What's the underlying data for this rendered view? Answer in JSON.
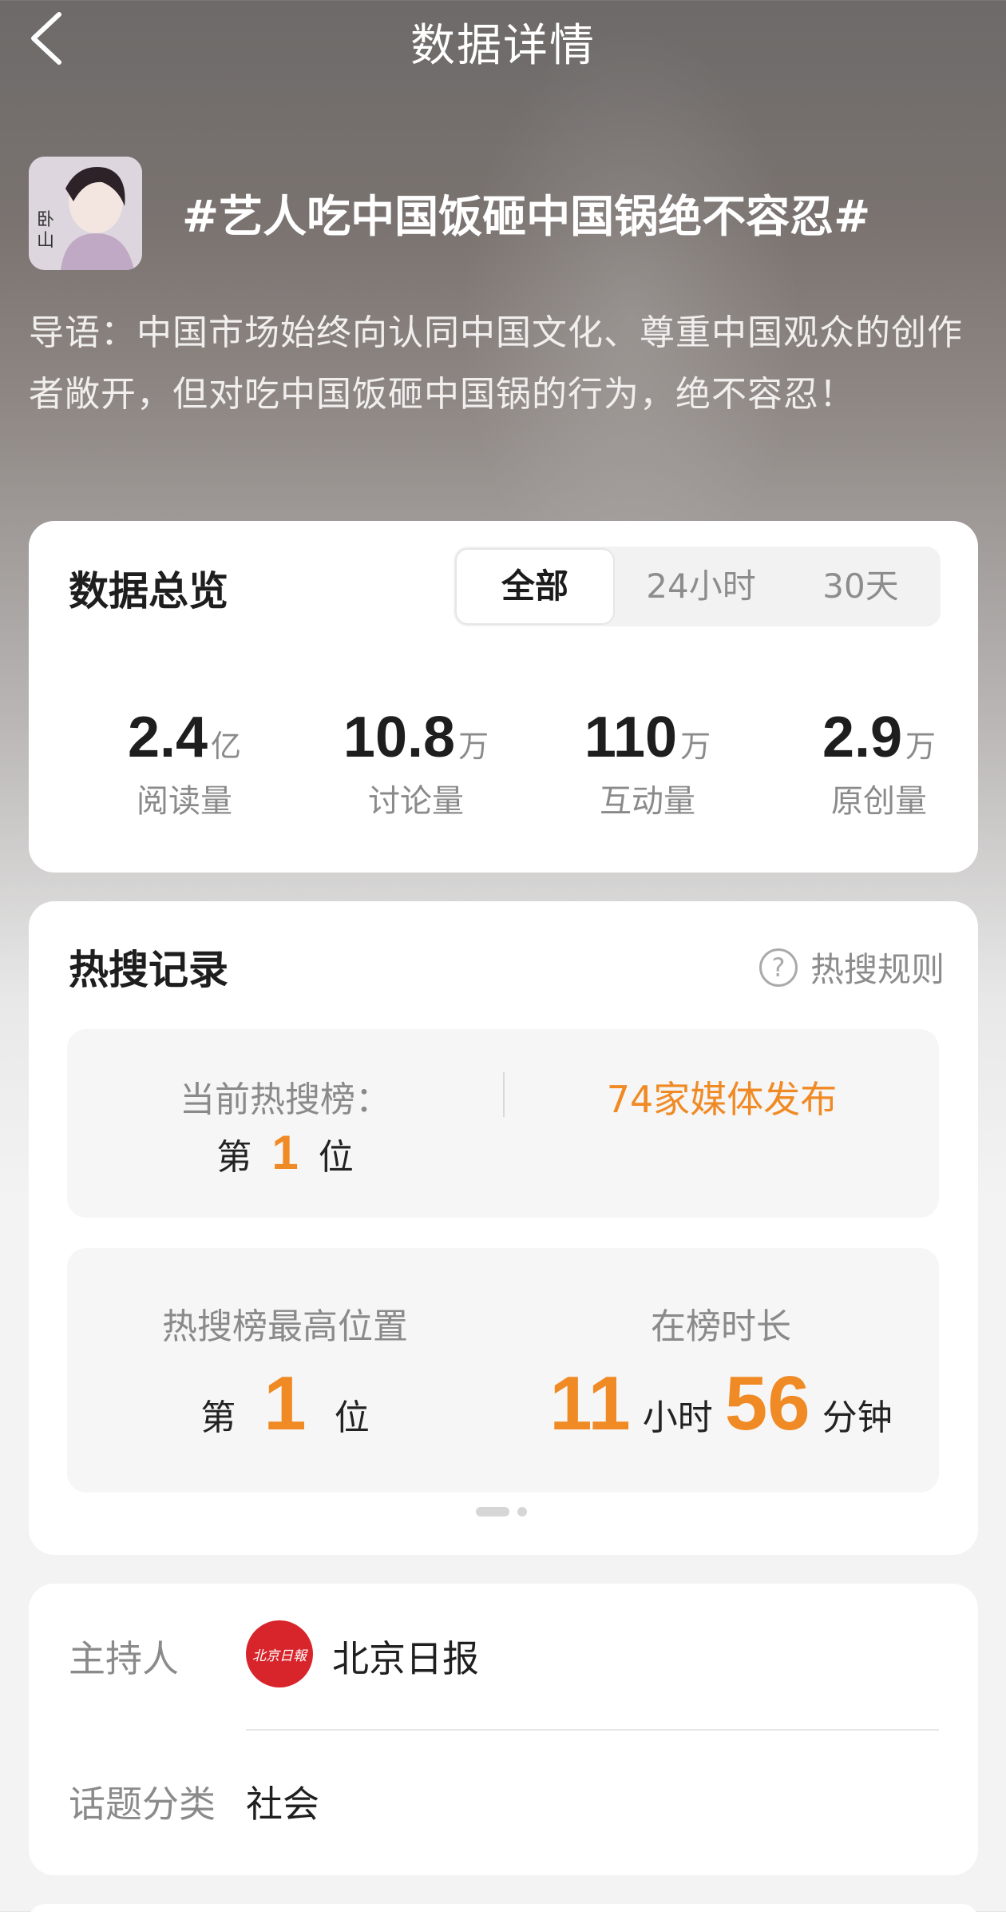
{
  "header": {
    "title": "数据详情"
  },
  "topic": {
    "title": "#艺人吃中国饭砸中国锅绝不容忍#",
    "intro": "导语：中国市场始终向认同中国文化、尊重中国观众的创作者敞开，但对吃中国饭砸中国锅的行为，绝不容忍！"
  },
  "overview": {
    "title": "数据总览",
    "tabs": [
      {
        "label": "全部",
        "active": true
      },
      {
        "label": "24小时",
        "active": false
      },
      {
        "label": "30天",
        "active": false
      }
    ],
    "stats": [
      {
        "value": "2.4",
        "unit": "亿",
        "label": "阅读量"
      },
      {
        "value": "10.8",
        "unit": "万",
        "label": "讨论量"
      },
      {
        "value": "110",
        "unit": "万",
        "label": "互动量"
      },
      {
        "value": "2.9",
        "unit": "万",
        "label": "原创量"
      }
    ]
  },
  "hot": {
    "title": "热搜记录",
    "rules_label": "热搜规则",
    "current_label": "当前热搜榜：",
    "current_prefix": "第",
    "current_rank": "1",
    "current_suffix": "位",
    "media_text": "74家媒体发布",
    "highest_label": "热搜榜最高位置",
    "highest_prefix": "第",
    "highest_rank": "1",
    "highest_suffix": "位",
    "duration_label": "在榜时长",
    "duration_hours": "11",
    "hours_unit": "小时",
    "duration_minutes": "56",
    "minutes_unit": "分钟",
    "pager_pages": 2,
    "pager_current": 1
  },
  "info": {
    "host_label": "主持人",
    "host_name": "北京日报",
    "host_logo_text": "北京日報",
    "category_label": "话题分类",
    "category_value": "社会"
  },
  "colors": {
    "accent": "#f08a24",
    "host_logo": "#d8252b"
  },
  "icons": [
    "back-chevron-icon",
    "help-circle-icon"
  ]
}
